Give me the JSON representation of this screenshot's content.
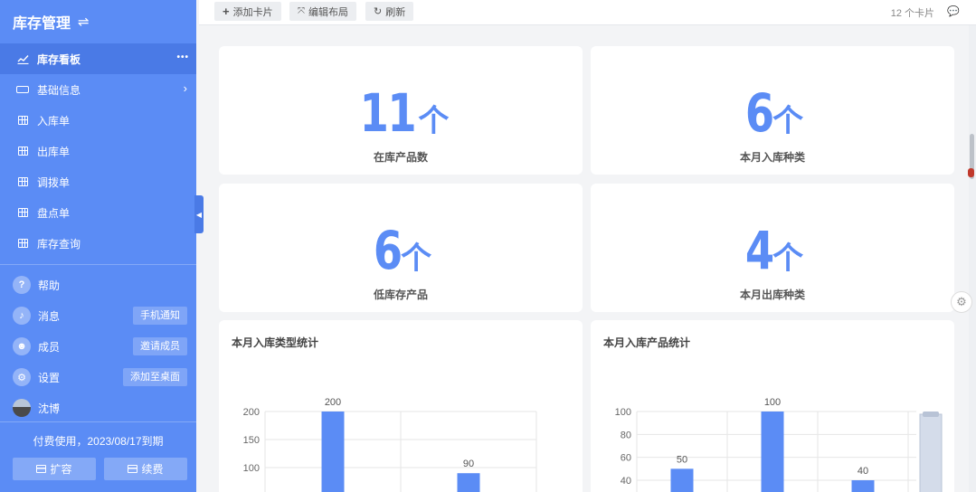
{
  "sidebar": {
    "title": "库存管理",
    "swap_icon": "⇌",
    "nav": [
      {
        "label": "库存看板",
        "icon": "line-chart-icon",
        "active": true
      },
      {
        "label": "基础信息",
        "icon": "rectangle-icon"
      },
      {
        "label": "入库单",
        "icon": "table-icon"
      },
      {
        "label": "出库单",
        "icon": "table-icon"
      },
      {
        "label": "调拨单",
        "icon": "table-icon"
      },
      {
        "label": "盘点单",
        "icon": "table-icon"
      },
      {
        "label": "库存查询",
        "icon": "table-icon"
      }
    ],
    "utils": [
      {
        "label": "帮助",
        "icon": "help-icon"
      },
      {
        "label": "消息",
        "icon": "bell-icon",
        "button": "手机通知"
      },
      {
        "label": "成员",
        "icon": "members-icon",
        "button": "邀请成员"
      },
      {
        "label": "设置",
        "icon": "gear-icon",
        "button": "添加至桌面"
      },
      {
        "label": "沈博",
        "icon": "avatar"
      }
    ],
    "paid_text": "付费使用，2023/08/17到期",
    "expand_label": "扩容",
    "renew_label": "续费"
  },
  "topbar": {
    "add_card": "添加卡片",
    "edit_layout": "编辑布局",
    "refresh": "刷新",
    "card_count": "12 个卡片"
  },
  "stats": [
    {
      "value": "11",
      "unit": "个",
      "label": "在库产品数"
    },
    {
      "value": "6",
      "unit": "个",
      "label": "本月入库种类"
    },
    {
      "value": "6",
      "unit": "个",
      "label": "低库存产品"
    },
    {
      "value": "4",
      "unit": "个",
      "label": "本月出库种类"
    }
  ],
  "colors": {
    "accent": "#5b8cf5",
    "sidebar_bg": "#5b8cf5"
  },
  "chart_data": [
    {
      "type": "bar",
      "title": "本月入库类型统计",
      "yticks": [
        100,
        150,
        200
      ],
      "values": [
        200,
        90
      ],
      "data_labels": [
        "200",
        "90"
      ]
    },
    {
      "type": "bar",
      "title": "本月入库产品统计",
      "yticks": [
        40,
        60,
        80,
        100
      ],
      "values": [
        50,
        100,
        40
      ],
      "data_labels": [
        "50",
        "100",
        "40"
      ]
    }
  ]
}
